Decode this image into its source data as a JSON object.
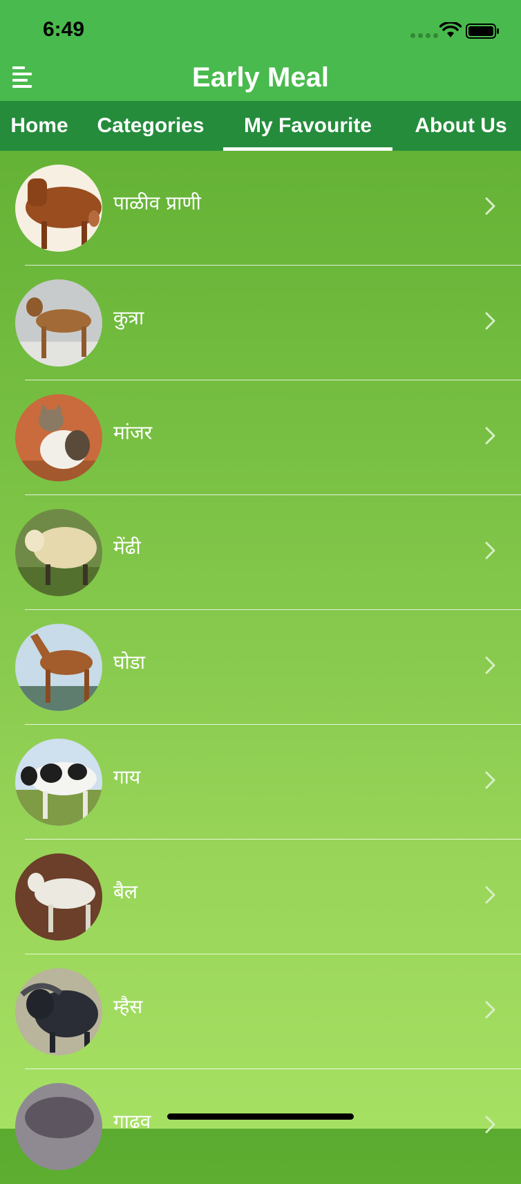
{
  "status_bar": {
    "time": "6:49"
  },
  "header": {
    "title": "Early Meal",
    "menu_icon": "hamburger-menu-icon"
  },
  "tabs": [
    {
      "label": "Home",
      "selected": false
    },
    {
      "label": "Categories",
      "selected": false
    },
    {
      "label": "My Favourite",
      "selected": true
    },
    {
      "label": "About Us",
      "selected": false
    }
  ],
  "items": [
    {
      "label": "पाळीव प्राणी",
      "image": "brown-cow-photo"
    },
    {
      "label": "कुत्रा",
      "image": "dog-photo"
    },
    {
      "label": "मांजर",
      "image": "cat-photo"
    },
    {
      "label": "मेंढी",
      "image": "sheep-photo"
    },
    {
      "label": "घोडा",
      "image": "horse-photo"
    },
    {
      "label": "गाय",
      "image": "cow-photo"
    },
    {
      "label": "बैल",
      "image": "bull-photo"
    },
    {
      "label": "म्हैस",
      "image": "buffalo-photo"
    },
    {
      "label": "गाढव",
      "image": "donkey-photo"
    }
  ],
  "colors": {
    "header_green": "#49ba4d",
    "tab_bar_green": "#258c3c",
    "list_gradient_top": "#5aab2f",
    "list_gradient_bottom": "#a6e063"
  }
}
